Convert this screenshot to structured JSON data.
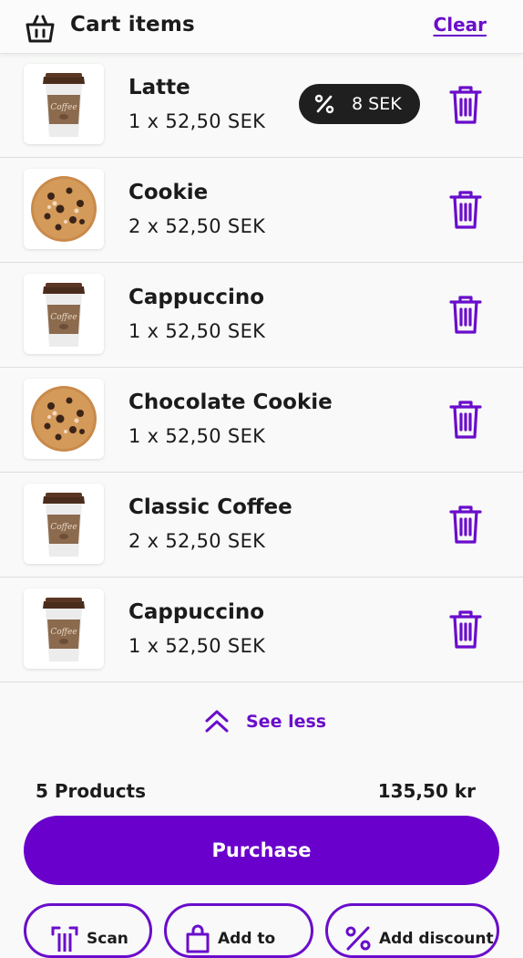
{
  "header": {
    "title": "Cart items",
    "clear_label": "Clear",
    "icon": "basket-icon"
  },
  "items": [
    {
      "name": "Latte",
      "qty": "1 x 52,50 SEK",
      "image": "coffee-cup",
      "discount": "8 SEK"
    },
    {
      "name": "Cookie",
      "qty": "2 x 52,50 SEK",
      "image": "cookie"
    },
    {
      "name": "Cappuccino",
      "qty": "1 x 52,50 SEK",
      "image": "coffee-cup"
    },
    {
      "name": "Chocolate Cookie",
      "qty": "1 x 52,50 SEK",
      "image": "cookie"
    },
    {
      "name": "Classic Coffee",
      "qty": "2 x 52,50 SEK",
      "image": "coffee-cup"
    },
    {
      "name": "Cappuccino",
      "qty": "1 x 52,50 SEK",
      "image": "coffee-cup"
    }
  ],
  "cup_label": "Coffee",
  "see_less": "See less",
  "summary": {
    "count": "5 Products",
    "total": "135,50 kr"
  },
  "purchase_label": "Purchase",
  "bottom_actions": [
    {
      "label": "Scan",
      "icon": "scan-icon"
    },
    {
      "label": "Add to",
      "icon": "bag-icon"
    },
    {
      "label": "Add discount",
      "icon": "percent-icon"
    }
  ],
  "colors": {
    "accent": "#6a00cc",
    "badge_bg": "#1f1f1f",
    "text": "#1b1b1b"
  }
}
